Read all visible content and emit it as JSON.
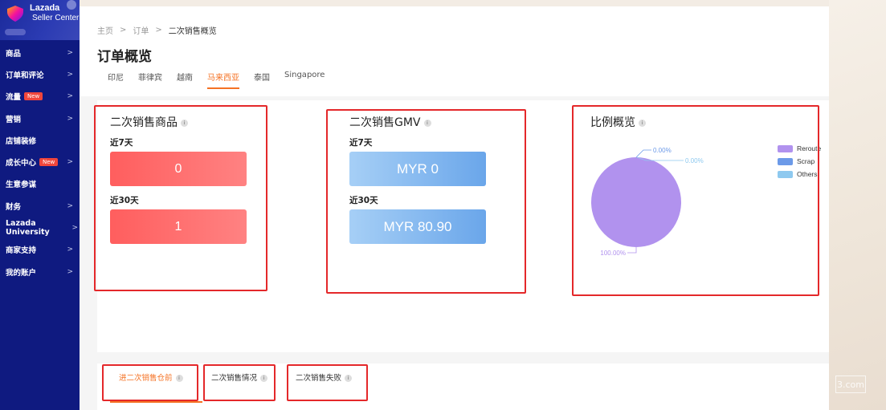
{
  "brand": {
    "title": "Lazada",
    "subtitle": "Seller Center"
  },
  "sidebar": {
    "items": [
      {
        "label": "商品",
        "has_chevron": true
      },
      {
        "label": "订单和评论",
        "has_chevron": true
      },
      {
        "label": "流量",
        "badge": "New",
        "has_chevron": true
      },
      {
        "label": "营销",
        "has_chevron": true
      },
      {
        "label": "店铺装修",
        "has_chevron": false
      },
      {
        "label": "成长中心",
        "badge": "New",
        "has_chevron": true
      },
      {
        "label": "生意参谋",
        "has_chevron": false
      },
      {
        "label": "财务",
        "has_chevron": true
      },
      {
        "label": "Lazada University",
        "has_chevron": true
      },
      {
        "label": "商家支持",
        "has_chevron": true
      },
      {
        "label": "我的账户",
        "has_chevron": true
      }
    ],
    "chevron": ">"
  },
  "breadcrumb": {
    "home": "主页",
    "orders": "订单",
    "current": "二次销售概览",
    "separator": ">"
  },
  "page_title": "订单概览",
  "country_tabs": [
    "印尼",
    "菲律宾",
    "越南",
    "马来西亚",
    "泰国",
    "Singapore"
  ],
  "active_country_tab": "马来西亚",
  "cards": {
    "items": {
      "title": "二次销售商品",
      "label_7d_prefix": "近",
      "label_7d_num": "7",
      "label_7d_suffix": "天",
      "value_7d": "0",
      "label_30d_prefix": "近",
      "label_30d_num": "30",
      "label_30d_suffix": "天",
      "value_30d": "1"
    },
    "gmv": {
      "title": "二次销售GMV",
      "label_7d_prefix": "近",
      "label_7d_num": "7",
      "label_7d_suffix": "天",
      "value_7d": "MYR 0",
      "label_30d_prefix": "近",
      "label_30d_num": "30",
      "label_30d_suffix": "天",
      "value_30d": "MYR 80.90"
    },
    "ratio": {
      "title": "比例概览",
      "label_a": "0.00%",
      "label_b": "0.00%",
      "label_c": "100.00%"
    }
  },
  "info_icon_glyph": "i",
  "chart_data": {
    "type": "pie",
    "title": "",
    "series": [
      {
        "name": "Reroute",
        "value": 100.0,
        "color": "#b192ee"
      },
      {
        "name": "Scrap",
        "value": 0.0,
        "color": "#6c9ae8"
      },
      {
        "name": "Others",
        "value": 0.0,
        "color": "#8ec9ef"
      }
    ],
    "data_labels": [
      "100.00%",
      "0.00%",
      "0.00%"
    ],
    "legend_position": "top-right"
  },
  "bottom_tabs": [
    "进二次销售仓前",
    "二次销售情况",
    "二次销售失败"
  ],
  "active_bottom_tab": "进二次销售仓前",
  "watermark_text": "3.com",
  "colors": {
    "accent": "#f57224",
    "sidebar": "#0f1a80",
    "highlight": "#e4282a"
  }
}
